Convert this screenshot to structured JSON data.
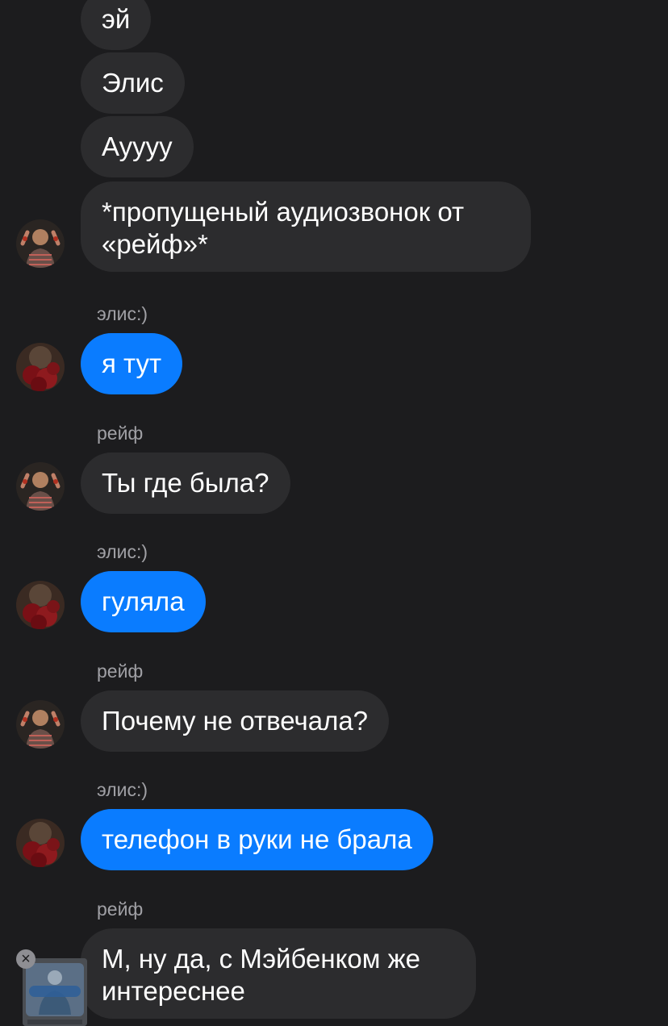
{
  "messages": [
    {
      "sender": "reif",
      "text": "эй"
    },
    {
      "sender": "reif",
      "text": "Элис"
    },
    {
      "sender": "reif",
      "text": "Ауууу"
    },
    {
      "sender": "reif",
      "text": "*пропущеный аудиозвонок от «рейф»*"
    },
    {
      "sender": "alice",
      "name": "элис:)",
      "text": "я тут"
    },
    {
      "sender": "reif",
      "name": "рейф",
      "text": "Ты где была?"
    },
    {
      "sender": "alice",
      "name": "элис:)",
      "text": "гуляла"
    },
    {
      "sender": "reif",
      "name": "рейф",
      "text": "Почему не отвечала?"
    },
    {
      "sender": "alice",
      "name": "элис:)",
      "text": "телефон в руки не брала"
    },
    {
      "sender": "reif",
      "name": "рейф",
      "text": "М, ну да, с Мэйбенком же интереснее"
    }
  ],
  "colors": {
    "background": "#1c1c1e",
    "incoming_bubble": "#2c2c2e",
    "outgoing_bubble": "#0a7cff",
    "sender_name": "#a0a0a5"
  },
  "icons": {
    "pip_close": "close-icon"
  }
}
